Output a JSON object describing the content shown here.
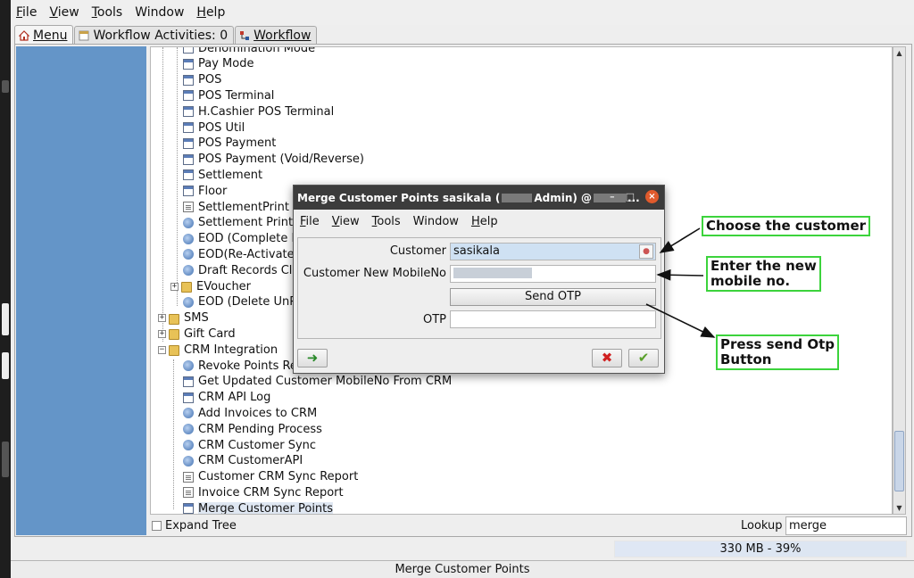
{
  "menubar": [
    {
      "label": "File",
      "u": "F",
      "rest": "ile"
    },
    {
      "label": "View",
      "u": "V",
      "rest": "iew"
    },
    {
      "label": "Tools",
      "u": "T",
      "rest": "ools"
    },
    {
      "label": "Window",
      "u": "",
      "rest": "Window"
    },
    {
      "label": "Help",
      "u": "H",
      "rest": "elp"
    }
  ],
  "tabs": {
    "menu": "Menu",
    "activities": "Workflow Activities: 0",
    "workflow": "Workflow"
  },
  "tree": {
    "items": [
      {
        "label": "Denomination Mode",
        "icon": "window-icon"
      },
      {
        "label": "Pay Mode",
        "icon": "window-icon"
      },
      {
        "label": "POS",
        "icon": "window-icon"
      },
      {
        "label": "POS Terminal",
        "icon": "window-icon"
      },
      {
        "label": "H.Cashier POS Terminal",
        "icon": "window-icon"
      },
      {
        "label": "POS Util",
        "icon": "window-icon"
      },
      {
        "label": "POS Payment",
        "icon": "window-icon"
      },
      {
        "label": "POS Payment (Void/Reverse)",
        "icon": "window-icon"
      },
      {
        "label": "Settlement",
        "icon": "window-icon"
      },
      {
        "label": "Floor",
        "icon": "window-icon"
      },
      {
        "label": "SettlementPrint",
        "icon": "report-icon"
      },
      {
        "label": "Settlement Print",
        "icon": "process-icon"
      },
      {
        "label": "EOD (Complete P",
        "icon": "process-icon"
      },
      {
        "label": "EOD(Re-Activate",
        "icon": "process-icon"
      },
      {
        "label": "Draft Records Cle",
        "icon": "process-icon"
      },
      {
        "label": "EVoucher",
        "icon": "folder-icon"
      },
      {
        "label": "EOD (Delete UnP",
        "icon": "process-icon"
      },
      {
        "label": "SMS",
        "icon": "folder-icon"
      },
      {
        "label": "Gift Card",
        "icon": "folder-icon"
      },
      {
        "label": "CRM Integration",
        "icon": "folder-open-icon"
      },
      {
        "label": "Revoke Points Re",
        "icon": "process-icon"
      },
      {
        "label": "Get Updated Customer MobileNo From CRM",
        "icon": "window-icon"
      },
      {
        "label": "CRM API Log",
        "icon": "window-icon"
      },
      {
        "label": "Add Invoices to CRM",
        "icon": "process-icon"
      },
      {
        "label": "CRM Pending Process",
        "icon": "process-icon"
      },
      {
        "label": "CRM Customer Sync",
        "icon": "process-icon"
      },
      {
        "label": "CRM CustomerAPI",
        "icon": "process-icon"
      },
      {
        "label": "Customer CRM Sync Report",
        "icon": "report-icon"
      },
      {
        "label": "Invoice CRM Sync Report",
        "icon": "report-icon"
      },
      {
        "label": "Merge Customer Points",
        "icon": "window-icon"
      }
    ]
  },
  "expand_tree_label": "Expand Tree",
  "lookup": {
    "label": "Lookup",
    "value": "merge"
  },
  "memory": {
    "text": "330 MB - 39%",
    "fraction": 0.39
  },
  "status": "Merge Customer Points",
  "dialog": {
    "title_prefix": "Merge Customer Points  sasikala (",
    "title_mid": "Admin) @",
    "title_suffix": "...",
    "minimize": "–",
    "maximize": "□",
    "close": "×",
    "menu": [
      {
        "u": "F",
        "rest": "ile"
      },
      {
        "u": "V",
        "rest": "iew"
      },
      {
        "u": "T",
        "rest": "ools"
      },
      {
        "u": "",
        "rest": "Window"
      },
      {
        "u": "H",
        "rest": "elp"
      }
    ],
    "customer_label": "Customer",
    "customer_value": "sasikala",
    "mobile_label": "Customer New MobileNo",
    "send_otp": "Send OTP",
    "otp_label": "OTP",
    "refresh_glyph": "➜",
    "cancel_glyph": "✖",
    "ok_glyph": "✔"
  },
  "annotations": {
    "choose": "Choose the customer",
    "enter_line1": "Enter the new",
    "enter_line2": "mobile no.",
    "press_line1": "Press send Otp",
    "press_line2": "Button"
  },
  "colors": {
    "side_panel": "#6495c8",
    "annotation_border": "#3cd33c",
    "close_button": "#e05a2c"
  }
}
